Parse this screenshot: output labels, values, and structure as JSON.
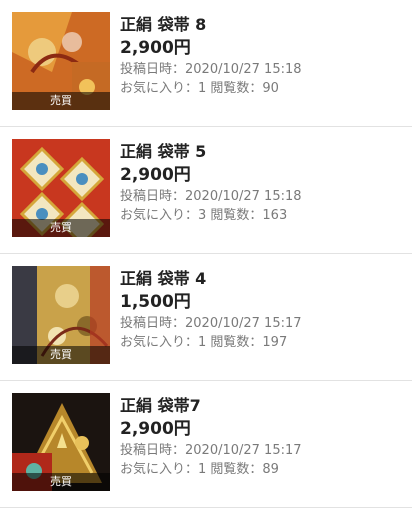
{
  "listings": [
    {
      "title": "正絹 袋帯 8",
      "price": "2,900円",
      "posted": "投稿日時：2020/10/27 15:18",
      "stats": "お気に入り：1 閲覧数：90",
      "badge": "売買"
    },
    {
      "title": "正絹 袋帯 5",
      "price": "2,900円",
      "posted": "投稿日時：2020/10/27 15:18",
      "stats": "お気に入り：3 閲覧数：163",
      "badge": "売買"
    },
    {
      "title": "正絹 袋帯 4",
      "price": "1,500円",
      "posted": "投稿日時：2020/10/27 15:17",
      "stats": "お気に入り：1 閲覧数：197",
      "badge": "売買"
    },
    {
      "title": "正絹 袋帯7",
      "price": "2,900円",
      "posted": "投稿日時：2020/10/27 15:17",
      "stats": "お気に入り：1 閲覧数：89",
      "badge": "売買"
    }
  ],
  "thumb_colors": {
    "orange": "#d7782a",
    "red": "#c8371f",
    "gold": "#c9a24a",
    "black": "#1b1410"
  }
}
